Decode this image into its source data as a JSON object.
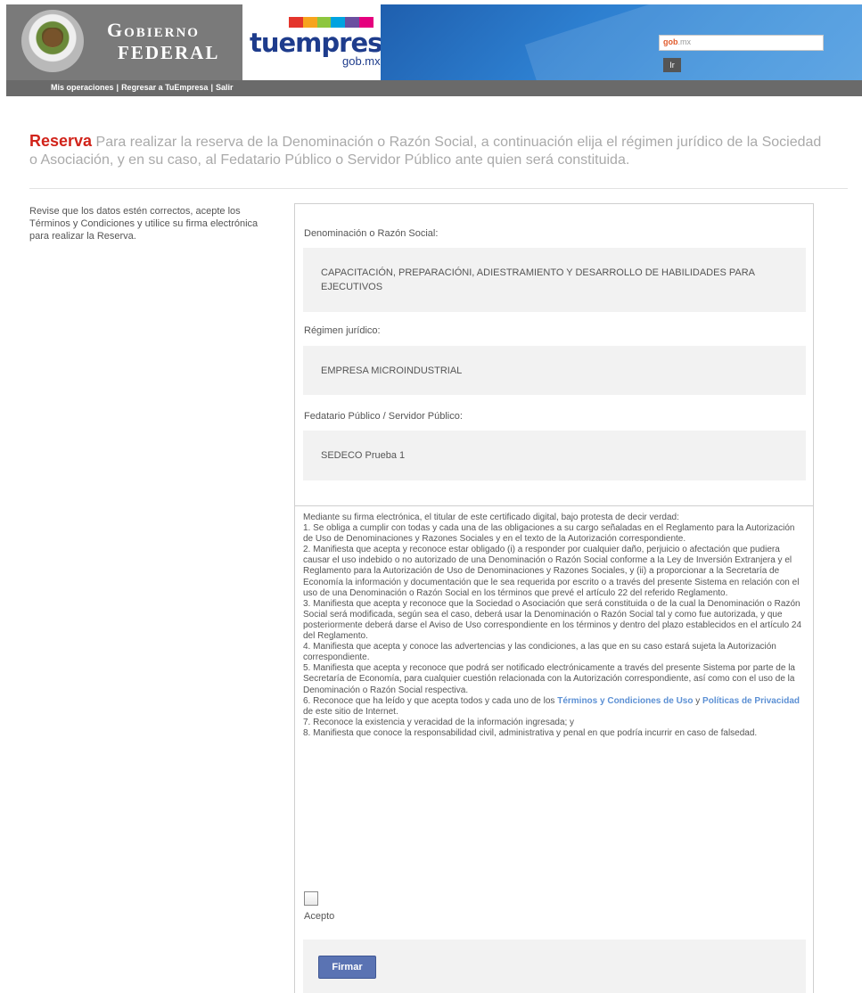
{
  "header": {
    "gov_line1": "Gobierno",
    "gov_line2": "Federal",
    "brand_name": "tuempresa",
    "brand_domain": "gob.mx",
    "search_brand": "gob",
    "search_brand_suffix": ".mx",
    "search_button": "Ir",
    "nav_links": [
      "Mis operaciones",
      "Regresar a TuEmpresa",
      "Salir"
    ],
    "brand_bar_colors": [
      "#e4352c",
      "#f7a41d",
      "#8dc63f",
      "#00a3e0",
      "#6b4fa0",
      "#e5007e"
    ]
  },
  "page": {
    "title_accent": "Reserva",
    "title_text": "Para realizar la reserva de la Denominación o Razón Social, a continuación elija el régimen jurídico de la Sociedad o Asociación, y en su caso, al Fedatario Público o Servidor Público ante quien será constituida.",
    "left_note": "Revise que los datos estén correctos, acepte los Términos y Condiciones y utilice su firma electrónica para realizar la Reserva."
  },
  "form": {
    "denominacion_label": "Denominación o Razón Social:",
    "denominacion_value": "CAPACITACIÓN, PREPARACIÓNI, ADIESTRAMIENTO Y DESARROLLO DE HABILIDADES PARA EJECUTIVOS",
    "regimen_label": "Régimen jurídico:",
    "regimen_value": "EMPRESA MICROINDUSTRIAL",
    "fedatario_label": "Fedatario Público / Servidor Público:",
    "fedatario_value": "SEDECO Prueba 1"
  },
  "terms": {
    "intro": "Mediante su firma electrónica, el titular de este certificado digital, bajo protesta de decir verdad:",
    "item1": "1. Se obliga a cumplir con todas y cada una de las obligaciones a su cargo señaladas en el Reglamento para la Autorización de Uso de Denominaciones y Razones Sociales y en el texto de la Autorización correspondiente.",
    "item2": "2. Manifiesta que acepta y reconoce estar obligado (i) a responder por cualquier daño, perjuicio o afectación que pudiera causar el uso indebido o no autorizado de una Denominación o Razón Social conforme a la Ley de Inversión Extranjera y el Reglamento para la Autorización de Uso de Denominaciones y Razones Sociales, y (ii) a proporcionar a la Secretaría de Economía la información y documentación que le sea requerida por escrito o a través del presente Sistema en relación con el uso de una Denominación o Razón Social en los términos que prevé el artículo 22 del referido Reglamento.",
    "item3": "3. Manifiesta que acepta y reconoce que la Sociedad o Asociación que será constituida o de la cual la Denominación o Razón Social será modificada, según sea el caso, deberá usar la Denominación o Razón Social tal y como fue autorizada, y que posteriormente deberá darse el Aviso de Uso correspondiente en los términos y dentro del plazo establecidos en el artículo 24 del Reglamento.",
    "item4": "4. Manifiesta que acepta y conoce las advertencias y las condiciones, a las que en su caso estará sujeta la Autorización correspondiente.",
    "item5": "5. Manifiesta que acepta y reconoce que podrá ser notificado electrónicamente a través del presente Sistema por parte de la Secretaría de Economía, para cualquier cuestión relacionada con la Autorización correspondiente, así como con el uso de la Denominación o Razón Social respectiva.",
    "item6_prefix": "6. Reconoce que ha leído y que acepta todos y cada uno de los",
    "item6_link1": "Términos y Condiciones de Uso",
    "item6_and": "y",
    "item6_link2": "Políticas de Privacidad",
    "item6_suffix": "de este sitio de Internet.",
    "item7": "7. Reconoce la existencia y veracidad de la información ingresada; y",
    "item8": "8. Manifiesta que conoce la responsabilidad civil, administrativa y penal en que podría incurrir en caso de falsedad.",
    "accept_label": "Acepto",
    "sign_button": "Firmar"
  }
}
